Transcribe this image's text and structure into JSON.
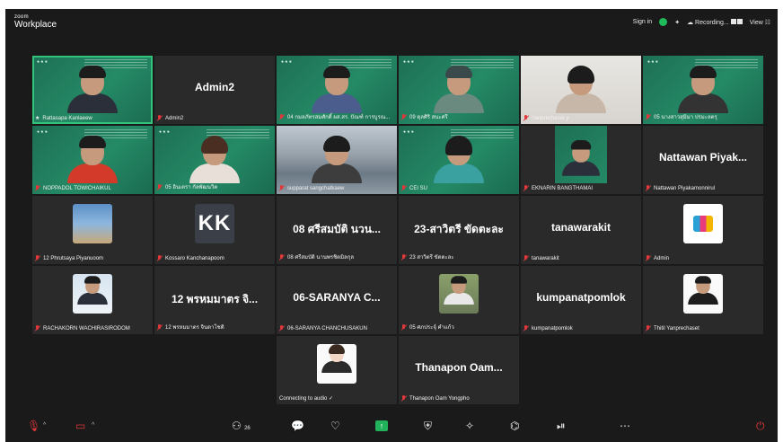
{
  "app": {
    "brand_small": "zoom",
    "brand": "Workplace"
  },
  "header": {
    "sign_in": "Sign in",
    "recording": "Recording...",
    "view": "View"
  },
  "tiles": [
    {
      "id": "t1",
      "name": "Rattasapa Kanlaeew",
      "kind": "video-green",
      "speaking": true,
      "star": true
    },
    {
      "id": "t2",
      "name": "Admin2",
      "kind": "name",
      "big": "Admin2"
    },
    {
      "id": "t3",
      "name": "04 กมลภัทรสมศักดิ์ ผส.สร. ปัณฑ์ การบูรณ...",
      "kind": "video-green"
    },
    {
      "id": "t4",
      "name": "09 ดุลศิริ สนะศรี",
      "kind": "video-green"
    },
    {
      "id": "t5",
      "name": "Yanprechaset y",
      "kind": "video-white"
    },
    {
      "id": "t6",
      "name": "05 นางสาวสุมิมา ปรมะลตรุ",
      "kind": "video-green"
    },
    {
      "id": "t7",
      "name": "NOPPADOL TOWICHAIKUL",
      "kind": "video-green"
    },
    {
      "id": "t8",
      "name": "05 อินเตรา กัลพัฒนวิต",
      "kind": "video-green"
    },
    {
      "id": "t9",
      "name": "supparat sangchatkaew",
      "kind": "video-city"
    },
    {
      "id": "t10",
      "name": "CEI SU",
      "kind": "video-green"
    },
    {
      "id": "t11",
      "name": "EKNARIN BANGTHAMAI",
      "kind": "video-green-small"
    },
    {
      "id": "t12",
      "name": "Nattawan Piyakamonnirul",
      "kind": "name",
      "big": "Nattawan  Piyak..."
    },
    {
      "id": "t13",
      "name": "12 Phrutsaya Piyanuoom",
      "kind": "avatar-room"
    },
    {
      "id": "t14",
      "name": "Kossaro Kanchanapoom",
      "kind": "avatar-kk",
      "avatar_text": "KK"
    },
    {
      "id": "t15",
      "name": "08 ศรีสมบัติ นานพรชิตมิลกุล",
      "kind": "name",
      "big": "08 ศรีสมบัติ นวน..."
    },
    {
      "id": "t16",
      "name": "23 สาวิตรี ขัดตะละ",
      "kind": "name",
      "big": "23-สาวิตรี ขัดตะละ"
    },
    {
      "id": "t17",
      "name": "tanawarakit",
      "kind": "name",
      "big": "tanawarakit"
    },
    {
      "id": "t18",
      "name": "Admin",
      "kind": "avatar-logo"
    },
    {
      "id": "t19",
      "name": "RACHAKORN WACHIRASIRODOM",
      "kind": "avatar-portrait"
    },
    {
      "id": "t20",
      "name": "12 พรหมมาตร จินดาโชติ",
      "kind": "name",
      "big": "12 พรหมมาตร จิ..."
    },
    {
      "id": "t21",
      "name": "06-SARANYA CHANCHUSAKUN",
      "kind": "name",
      "big": "06-SARANYA  C..."
    },
    {
      "id": "t22",
      "name": "05 ศภประจุ์ คำแก้ว",
      "kind": "avatar-portrait2"
    },
    {
      "id": "t23",
      "name": "kumpanatpomlok",
      "kind": "name",
      "big": "kumpanatpomlok"
    },
    {
      "id": "t24",
      "name": "Thitil Yanprechaset",
      "kind": "avatar-portrait3"
    },
    {
      "id": "t25",
      "name": "Connecting to audio ✓",
      "kind": "avatar-anime",
      "no_mic": true
    },
    {
      "id": "t26",
      "name": "Thanapon Oam Yongpho",
      "kind": "name",
      "big": "Thanapon  Oam..."
    }
  ],
  "toolbar": {
    "participants_count": "26",
    "icons": {
      "mic": "mic-muted-icon",
      "video": "video-off-icon",
      "participants": "participants-icon",
      "chat": "chat-icon",
      "react": "react-icon",
      "share": "share-icon",
      "security": "security-icon",
      "ai": "ai-companion-icon",
      "apps": "apps-icon",
      "record": "record-icon",
      "more": "more-icon",
      "leave": "leave-icon"
    },
    "colors": {
      "share": "#22b25b",
      "muted": "#e0383b",
      "speaking": "#33c37a",
      "recording_shield": "#1fba5a"
    }
  }
}
